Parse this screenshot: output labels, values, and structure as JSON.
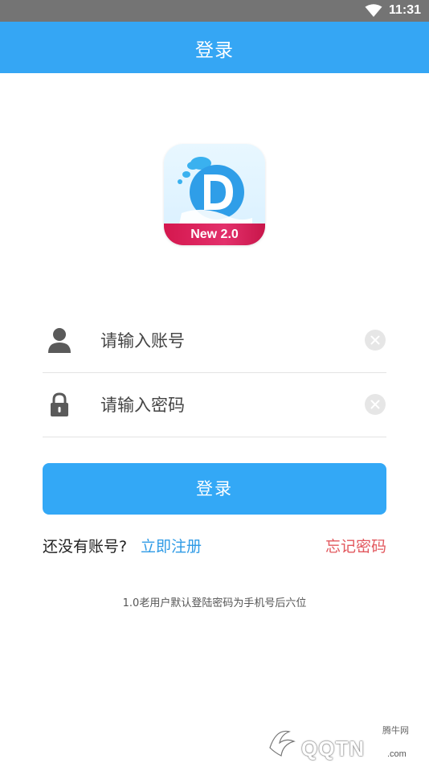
{
  "status_bar": {
    "time": "11:31",
    "wifi_icon": "wifi-icon"
  },
  "app_bar": {
    "title": "登录"
  },
  "logo": {
    "badge_text": "New  2.0",
    "letter": "D"
  },
  "form": {
    "account": {
      "placeholder": "请输入账号",
      "value": "",
      "icon": "user-icon"
    },
    "password": {
      "placeholder": "请输入密码",
      "value": "",
      "icon": "lock-icon"
    },
    "login_label": "登录"
  },
  "links": {
    "no_account": "还没有账号?",
    "register": "立即注册",
    "forgot": "忘记密码"
  },
  "hint": "1.0老用户默认登陆密码为手机号后六位",
  "watermark": {
    "logo_text": "QQTN",
    "cn": "腾牛网",
    "url": ".com"
  },
  "colors": {
    "primary": "#35a6f4",
    "button": "#33a8f6",
    "link": "#2f9be6",
    "forgot": "#e2585e",
    "status_bar": "#747474"
  }
}
